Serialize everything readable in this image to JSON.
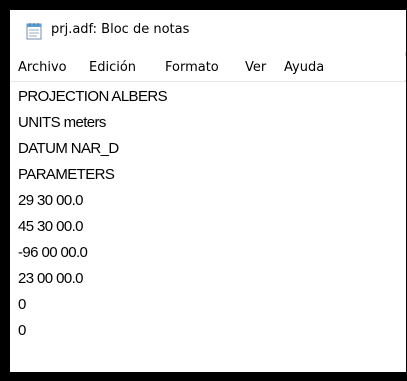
{
  "window": {
    "title": "prj.adf: Bloc de notas",
    "icon": "notepad-icon"
  },
  "menu": {
    "items": [
      {
        "label": "Archivo"
      },
      {
        "label": "Edición"
      },
      {
        "label": "Formato"
      },
      {
        "label": "Ver"
      },
      {
        "label": "Ayuda"
      }
    ]
  },
  "document": {
    "lines": [
      "PROJECTION ALBERS",
      "UNITS meters",
      "DATUM NAR_D",
      "PARAMETERS",
      "29 30 00.0",
      "45 30 00.0",
      "-96 00 00.0",
      "23 00 00.0",
      "0",
      "0"
    ]
  },
  "colors": {
    "frame": "#000000",
    "window_bg": "#ffffff",
    "text": "#000000",
    "icon_blue": "#5a9fd6"
  }
}
